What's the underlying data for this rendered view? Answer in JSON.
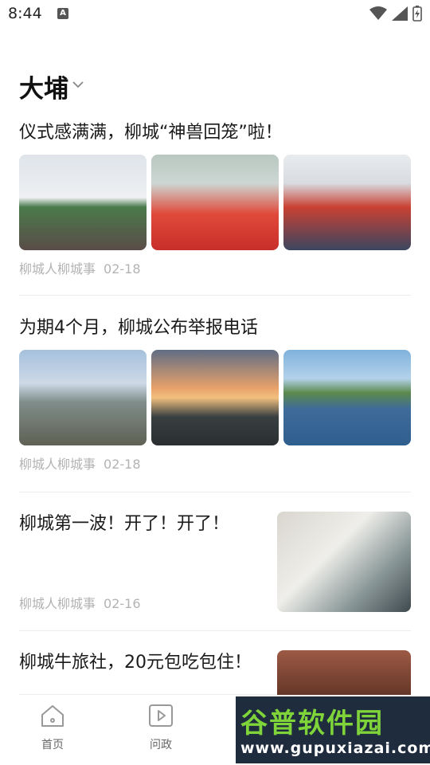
{
  "status_bar": {
    "time": "8:44",
    "notification_icon": "A"
  },
  "location": {
    "name": "大埔"
  },
  "articles": [
    {
      "title": "仪式感满满，柳城“神兽回笼”啦！",
      "source": "柳城人柳城事",
      "date": "02-18"
    },
    {
      "title": "为期4个月，柳城公布举报电话",
      "source": "柳城人柳城事",
      "date": "02-18"
    },
    {
      "title": "柳城第一波！开了！开了！",
      "source": "柳城人柳城事",
      "date": "02-16"
    },
    {
      "title": "柳城牛旅社，20元包吃包住！"
    }
  ],
  "bottom_nav": {
    "home_label": "首页",
    "politics_label": "问政"
  },
  "watermark": {
    "top": "谷普软件园",
    "bottom": "www.gupuxiazai.com"
  }
}
